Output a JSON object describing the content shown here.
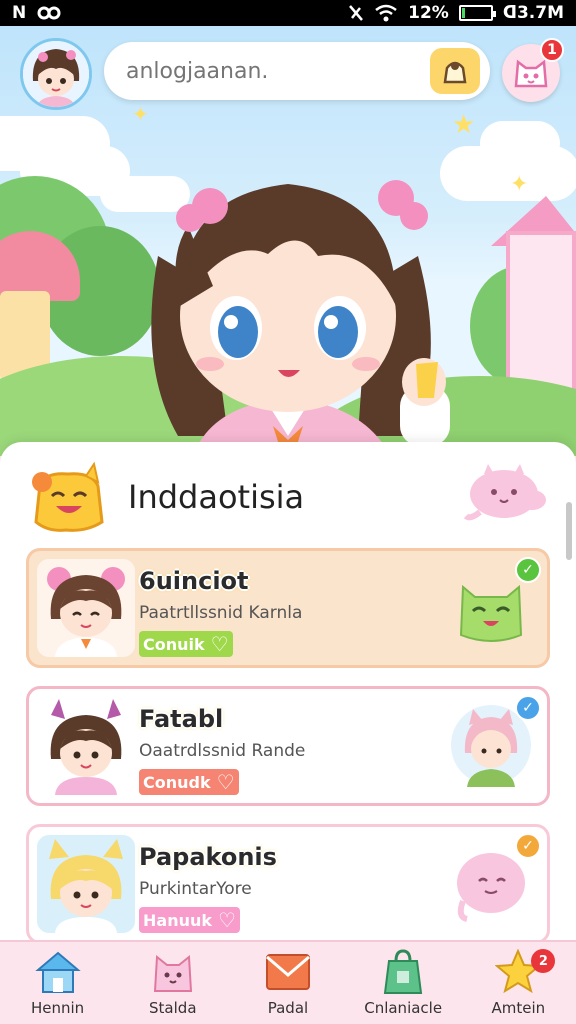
{
  "status_bar": {
    "left_text_1": "N",
    "left_text_2": "",
    "battery_text": "12%",
    "time_text": "ᗡ3.7M",
    "battery_level": 0.12,
    "icons": [
      "notification-icon",
      "settings-icon",
      "wifi-icon",
      "signal-icon",
      "battery-icon"
    ]
  },
  "header": {
    "search": {
      "placeholder": "anlogjaanan."
    },
    "notification_count": "1",
    "icons": [
      "avatar",
      "search-icon",
      "pet-icon"
    ]
  },
  "panel": {
    "title": "Inddaotisia",
    "cards": [
      {
        "name": "6uinciot",
        "subtitle": "Paatrtllssnid Karnla",
        "tag": "Conuik",
        "accent": "#f6c9a7",
        "tag_color": "#9fd84a",
        "check_color": "#5ac43f",
        "check_icon": "checkmark-icon"
      },
      {
        "name": "Fatabl",
        "subtitle": "Oaatrdlssnid Rande",
        "tag": "Conudk",
        "accent": "#f4b7c6",
        "tag_color": "#f58472",
        "check_color": "#4aa3e8",
        "check_icon": "checkmark-icon"
      },
      {
        "name": "Papakonis",
        "subtitle": "PurkintarYore",
        "tag": "Hanuuk",
        "accent": "#f8cad8",
        "tag_color": "#f79ccb",
        "check_color": "#f3a93a",
        "check_icon": "checkmark-icon"
      }
    ]
  },
  "bottom_nav": [
    {
      "label": "Hennin",
      "icon": "home-icon"
    },
    {
      "label": "Stalda",
      "icon": "cat-icon"
    },
    {
      "label": "Padal",
      "icon": "mail-icon"
    },
    {
      "label": "Cnlaniacle",
      "icon": "bag-icon"
    },
    {
      "label": "Amtein",
      "icon": "star-icon",
      "badge": "2"
    }
  ],
  "colors": {
    "accent_pink": "#f49cc3",
    "accent_yellow": "#fcd66a",
    "badge_red": "#e8363a"
  }
}
